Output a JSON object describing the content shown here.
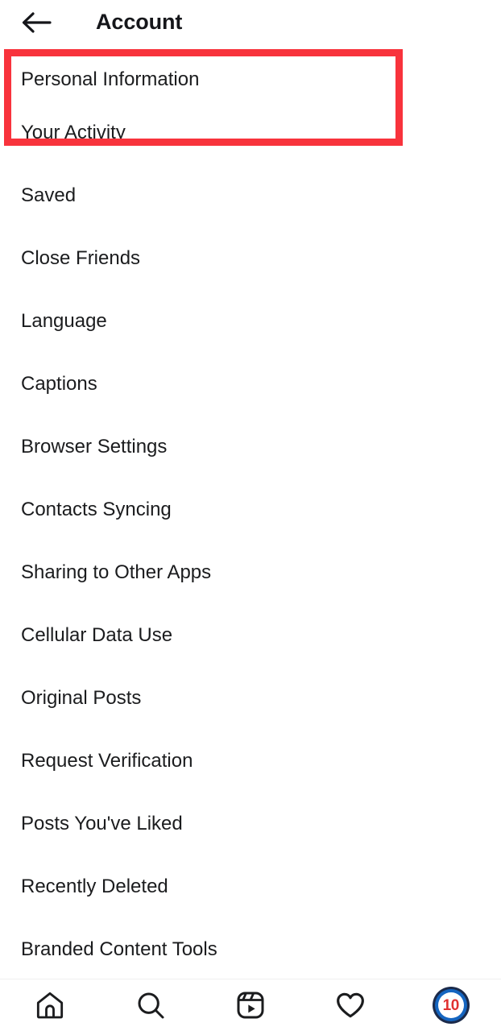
{
  "header": {
    "title": "Account",
    "back_icon": "arrow-left-icon"
  },
  "highlight": {
    "color": "#f8333c",
    "target": "Personal Information"
  },
  "menu": {
    "items": [
      {
        "label": "Personal Information"
      },
      {
        "label": "Your Activity"
      },
      {
        "label": "Saved"
      },
      {
        "label": "Close Friends"
      },
      {
        "label": "Language"
      },
      {
        "label": "Captions"
      },
      {
        "label": "Browser Settings"
      },
      {
        "label": "Contacts Syncing"
      },
      {
        "label": "Sharing to Other Apps"
      },
      {
        "label": "Cellular Data Use"
      },
      {
        "label": "Original Posts"
      },
      {
        "label": "Request Verification"
      },
      {
        "label": "Posts You've Liked"
      },
      {
        "label": "Recently Deleted"
      },
      {
        "label": "Branded Content Tools"
      }
    ]
  },
  "bottom_nav": {
    "items": [
      {
        "icon": "home-icon",
        "label": "Home"
      },
      {
        "icon": "search-icon",
        "label": "Search"
      },
      {
        "icon": "reels-icon",
        "label": "Reels"
      },
      {
        "icon": "heart-icon",
        "label": "Activity"
      },
      {
        "icon": "profile-avatar-icon",
        "label": "Profile"
      }
    ],
    "avatar_badge": "10",
    "avatar_badge_color": "#e03131"
  }
}
